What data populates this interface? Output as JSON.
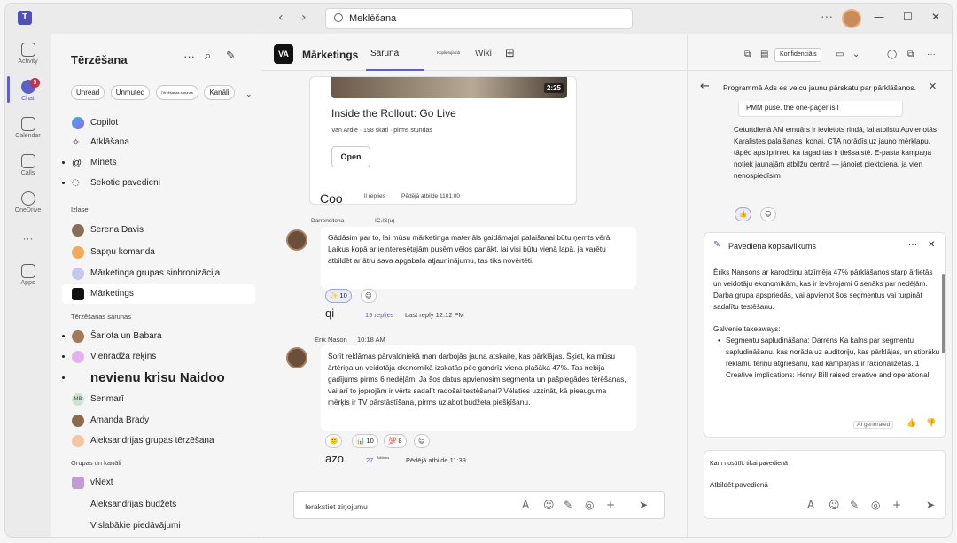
{
  "titlebar": {
    "search_value": "Meklēšana",
    "more": "···",
    "minimize": "—",
    "maximize": "☐",
    "close": "✕"
  },
  "rail": {
    "items": [
      {
        "label": "Activity",
        "icon": "bell-icon"
      },
      {
        "label": "Chat",
        "icon": "chat-icon",
        "badge": "5"
      },
      {
        "label": "Calendar",
        "icon": "calendar-icon"
      },
      {
        "label": "Calls",
        "icon": "phone-icon"
      },
      {
        "label": "OneDrive",
        "icon": "cloud-icon"
      },
      {
        "label": "···",
        "icon": "more-icon"
      },
      {
        "label": "Apps",
        "icon": "apps-icon"
      }
    ]
  },
  "chatlist": {
    "title": "Tērzēšana",
    "filters": [
      "Unread",
      "Unmuted",
      "Tērzēšanas sarunas",
      "Kanāli"
    ],
    "pinned": [
      {
        "label": "Copilot",
        "icon": "copilot-icon"
      },
      {
        "label": "Atklāšana",
        "icon": "sparkle-icon"
      },
      {
        "label": "Minēts",
        "icon": "at-icon"
      },
      {
        "label": "Sekotie pavedieni",
        "icon": "thread-icon"
      }
    ],
    "section_favorites": "Izlase",
    "favorites": [
      {
        "label": "Serena Davis"
      },
      {
        "label": "Sapņu komanda"
      },
      {
        "label": "Mārketinga grupas sinhronizācija"
      },
      {
        "label": "Mārketings"
      }
    ],
    "section_chats": "Tērzēšanas sarunas",
    "chats": [
      {
        "label": "Šarlota un Babara"
      },
      {
        "label": "Vienradža rēķins"
      },
      {
        "label": "nevienu krisu Naidoo"
      },
      {
        "label": "Senmarī"
      },
      {
        "label": "Amanda Brady"
      },
      {
        "label": "Aleksandrijas grupas tērzēšana"
      }
    ],
    "section_groups": "Grupas un kanāli",
    "groups": [
      {
        "label": "vNext"
      },
      {
        "label": "Aleksandrijas budžets"
      },
      {
        "label": "Vislabākie piedāvājumi"
      }
    ]
  },
  "channel": {
    "name": "Mārketings",
    "tabs": [
      "Saruna",
      "Koplietojamā",
      "Wiki"
    ],
    "card": {
      "duration": "2:25",
      "title": "Inside the Rollout: Go Live",
      "meta": "Van Ardle · 198 skati · pirms stundas",
      "button": "Open"
    },
    "thread1": {
      "name": "Coo",
      "replies": "ll replies",
      "last": "Pēdējā atbilde 1101:00"
    },
    "msg2": {
      "sender": "Darrensitona",
      "time": "IC.IS(u)",
      "text": "Gādāsim par to, lai mūsu mārketinga materiāls gaidāmajai palaišanai būtu ņemts vērā! Laikus kopā ar ieinteresētajām pusēm vēlos panākt, lai visi būtu vienā lapā. ja varētu atbildēt ar ātru sava apgabala atjauninājumu, tas tiks novērtēti.",
      "react1": "✨ 10",
      "name": "qi",
      "replies": "19 replies",
      "last": "Last reply 12:12 PM"
    },
    "msg3": {
      "sender": "Erik Nason",
      "time": "10:18 AM",
      "text": "Šorīt reklāmas pārvaldniekā man darbojās jauna atskaite, kas pārklājas. Šķiet, ka mūsu ārtēriņa un veidotāja ekonomikā izskatās pēc gandrīz viena plašāka 47%. Tas nebija gadījums pirms 6 nedēļām. Ja šos datus apvienosim segmenta un pašpiegādes tērēšanas, vai arī to joprojām ir vērts sadalīt radošai testēšanai? Vēlaties uzzināt, kā pieauguma mērķis ir TV pārstāstīšana, pirms uzlabot budžeta piešķīšanu.",
      "reactions": [
        "🙂",
        "📊 10",
        "💯 8"
      ],
      "name": "azo",
      "replies": "27",
      "small": "Atbildes",
      "last": "Pēdējā atbilde 11:39"
    },
    "composer_placeholder": "Ierakstiet ziņojumu"
  },
  "panel": {
    "sensitivity": "Konfidenciāls",
    "thread_title": "Programmā Ads es veicu jaunu pārskatu par pārklāšanos.",
    "quote": "PMM pusē. the one-pager is l",
    "body": "Ceturtdienā AM emuārs ir ievietots rindā, lai atbilstu Apvienotās Karalistes palaišanas ikonai. CTA norādīs uz jauno mērķlapu, tāpēc apstipriniet, ka tagad tas ir tiešsaistē. E-pasta kampaņa notiek jaunajām atbilžu centrā — jānoiet piektdiena, ja vien nenospiedīsim",
    "summary_title": "Pavediena kopsavilkums",
    "summary_p1": "Ēriks Nansons ar karodziņu atzīmēja 47% pārklāšanos starp ārlietās un veidotāju ekonomikām, kas ir ievērojami 6 senāks par nedēļām. Darba grupa apspriedās, vai apvienot šos segmentus vai turpināt sadalītu testēšanu.",
    "summary_heading": "Galvenie takeaways:",
    "summary_items": [
      "Segmentu sapludināšana: Darrens Ka kalns par segmentu sapludināšanu. kas norāda uz auditoriju, kas pārklājas, un stiprāku reklāmu tēriņu atgriešanu, kad kampaņas ir racionalizētas. 1",
      "Creative implications: Henry Bill raised creative and operational implications, including messaging"
    ],
    "ai_label": "AI generated",
    "reply_to": "Kam nosūtīt: tikai pavedienā",
    "reply_placeholder": "Atbildēt pavedienā"
  }
}
